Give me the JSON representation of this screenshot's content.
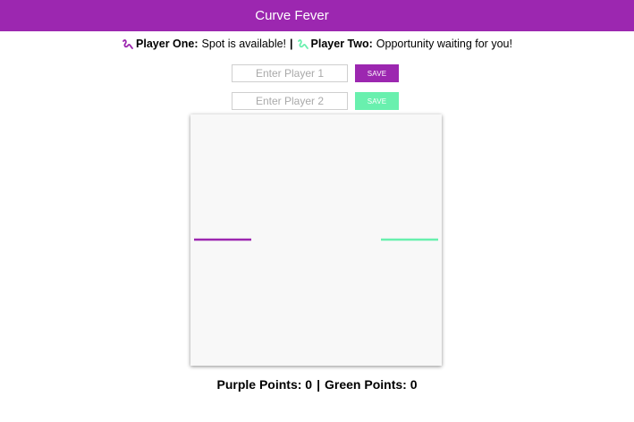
{
  "app": {
    "title": "Curve Fever"
  },
  "colors": {
    "purple": "#9c27b0",
    "green": "#69f0ae"
  },
  "status": {
    "player_one_label": "Player One:",
    "player_one_text": "Spot is available!",
    "separator": "|",
    "player_two_label": "Player Two:",
    "player_two_text": "Opportunity waiting for you!",
    "player_one_icon": "squiggle-icon",
    "player_two_icon": "squiggle-icon"
  },
  "form": {
    "player1_placeholder": "Enter Player 1",
    "player1_value": "",
    "player1_save": "SAVE",
    "player2_placeholder": "Enter Player 2",
    "player2_value": "",
    "player2_save": "SAVE"
  },
  "score": {
    "purple_label": "Purple Points:",
    "purple_points": "0",
    "separator": "|",
    "green_label": "Green Points:",
    "green_points": "0"
  }
}
